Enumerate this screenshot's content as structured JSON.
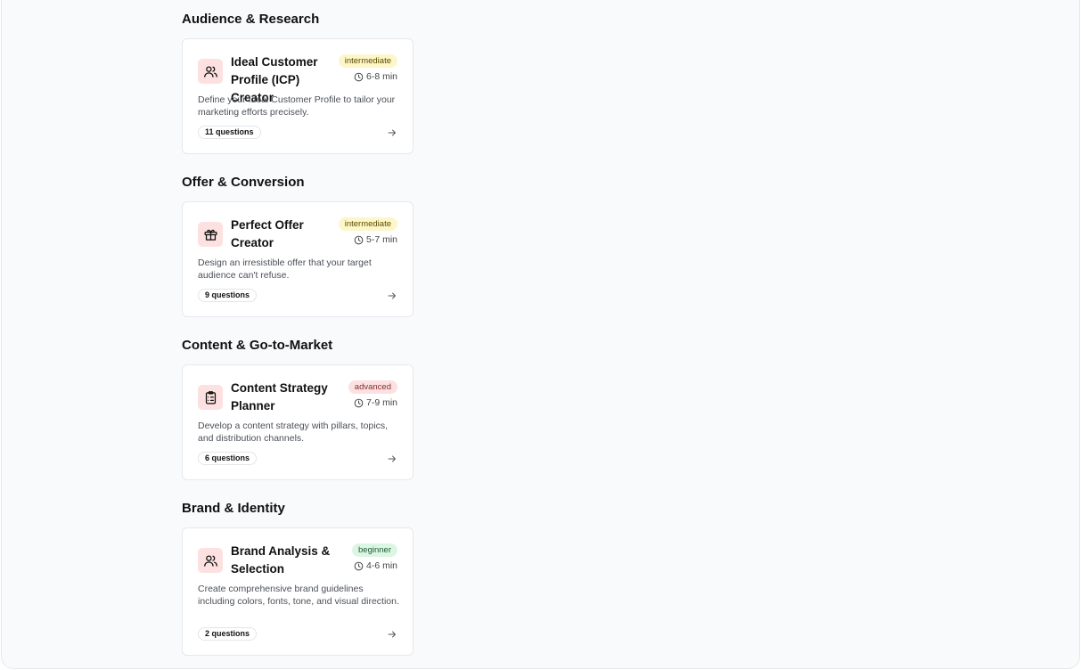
{
  "sections": [
    {
      "title": "Audience & Research",
      "card": {
        "icon": "users-icon",
        "title": "Ideal Customer Profile (ICP) Creator",
        "level": "intermediate",
        "duration": "6-8 min",
        "description": "Define your Ideal Customer Profile to tailor your marketing efforts precisely.",
        "questions": "11 questions"
      }
    },
    {
      "title": "Offer & Conversion",
      "card": {
        "icon": "gift-icon",
        "title": "Perfect Offer Creator",
        "level": "intermediate",
        "duration": "5-7 min",
        "description": "Design an irresistible offer that your target audience can't refuse.",
        "questions": "9 questions"
      }
    },
    {
      "title": "Content & Go-to-Market",
      "card": {
        "icon": "clipboard-list-icon",
        "title": "Content Strategy Planner",
        "level": "advanced",
        "duration": "7-9 min",
        "description": "Develop a content strategy with pillars, topics, and distribution channels.",
        "questions": "6 questions"
      }
    },
    {
      "title": "Brand & Identity",
      "card": {
        "icon": "users-icon",
        "title": "Brand Analysis & Selection",
        "level": "beginner",
        "duration": "4-6 min",
        "description": "Create comprehensive brand guidelines including colors, fonts, tone, and visual direction.",
        "questions": "2 questions"
      }
    }
  ],
  "colors": {
    "background": "#f9fafb",
    "card": "#ffffff",
    "icon_bg": "#fde1e1",
    "intermediate_bg": "#fdf6c8",
    "advanced_bg": "#fbe1e1",
    "beginner_bg": "#dcf6e4"
  }
}
